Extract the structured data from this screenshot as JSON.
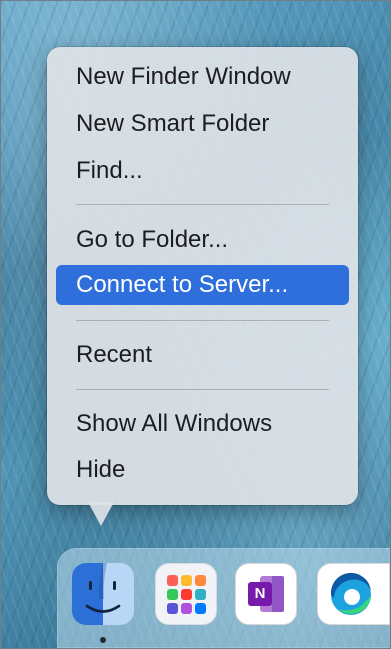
{
  "context_menu": {
    "items": [
      {
        "label": "New Finder Window"
      },
      {
        "label": "New Smart Folder"
      },
      {
        "label": "Find..."
      },
      {
        "label": "Go to Folder..."
      },
      {
        "label": "Connect to Server...",
        "selected": true
      },
      {
        "label": "Recent"
      },
      {
        "label": "Show All Windows"
      },
      {
        "label": "Hide"
      }
    ],
    "highlight_color": "#2f6fdb"
  },
  "dock": {
    "apps": [
      {
        "name": "Finder",
        "icon": "finder-icon",
        "running": true
      },
      {
        "name": "Launchpad",
        "icon": "launchpad-icon"
      },
      {
        "name": "OneNote",
        "icon": "onenote-icon",
        "glyph": "N"
      },
      {
        "name": "Microsoft Edge",
        "icon": "edge-icon"
      }
    ]
  }
}
